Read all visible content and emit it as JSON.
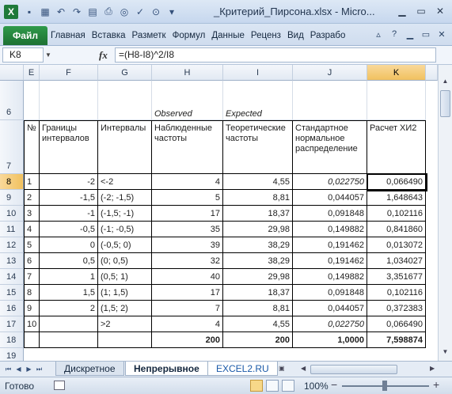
{
  "window": {
    "title": "_Критерий_Пирсона.xlsx - Micro...",
    "app_icon": "X"
  },
  "ribbon": {
    "file": "Файл",
    "tabs": [
      "Главная",
      "Вставка",
      "Разметк",
      "Формул",
      "Данные",
      "Реценз",
      "Вид",
      "Разрабо"
    ]
  },
  "formula_bar": {
    "name_box": "K8",
    "fx": "fx",
    "formula": "=(H8-I8)^2/I8"
  },
  "columns": [
    "E",
    "F",
    "G",
    "H",
    "I",
    "J",
    "K"
  ],
  "selected_column": "K",
  "rows": {
    "r6": {
      "num": "6",
      "H": "Observed",
      "I": "Expected"
    },
    "r7": {
      "num": "7",
      "E": "№",
      "F": "Границы интервалов",
      "G": "Интервалы",
      "H": "Наблюденные частоты",
      "I": "Теоретические частоты",
      "J": "Стандартное нормальное распределение",
      "K": "Расчет ХИ2"
    },
    "data": [
      {
        "num": "8",
        "E": "1",
        "F": "-2",
        "G": "<-2",
        "H": "4",
        "I": "4,55",
        "J": "0,022750",
        "K": "0,066490"
      },
      {
        "num": "9",
        "E": "2",
        "F": "-1,5",
        "G": "(-2; -1,5)",
        "H": "5",
        "I": "8,81",
        "J": "0,044057",
        "K": "1,648643"
      },
      {
        "num": "10",
        "E": "3",
        "F": "-1",
        "G": "(-1,5; -1)",
        "H": "17",
        "I": "18,37",
        "J": "0,091848",
        "K": "0,102116"
      },
      {
        "num": "11",
        "E": "4",
        "F": "-0,5",
        "G": "(-1; -0,5)",
        "H": "35",
        "I": "29,98",
        "J": "0,149882",
        "K": "0,841860"
      },
      {
        "num": "12",
        "E": "5",
        "F": "0",
        "G": "(-0,5; 0)",
        "H": "39",
        "I": "38,29",
        "J": "0,191462",
        "K": "0,013072"
      },
      {
        "num": "13",
        "E": "6",
        "F": "0,5",
        "G": "(0; 0,5)",
        "H": "32",
        "I": "38,29",
        "J": "0,191462",
        "K": "1,034027"
      },
      {
        "num": "14",
        "E": "7",
        "F": "1",
        "G": "(0,5; 1)",
        "H": "40",
        "I": "29,98",
        "J": "0,149882",
        "K": "3,351677"
      },
      {
        "num": "15",
        "E": "8",
        "F": "1,5",
        "G": "(1; 1,5)",
        "H": "17",
        "I": "18,37",
        "J": "0,091848",
        "K": "0,102116"
      },
      {
        "num": "16",
        "E": "9",
        "F": "2",
        "G": "(1,5; 2)",
        "H": "7",
        "I": "8,81",
        "J": "0,044057",
        "K": "0,372383"
      },
      {
        "num": "17",
        "E": "10",
        "F": "",
        "G": ">2",
        "H": "4",
        "I": "4,55",
        "J": "0,022750",
        "K": "0,066490"
      }
    ],
    "r18": {
      "num": "18",
      "H": "200",
      "I": "200",
      "J": "1,0000",
      "K": "7,598874"
    },
    "r19": {
      "num": "19"
    }
  },
  "sheets": [
    "Дискретное",
    "Непрерывное",
    "EXCEL2.RU"
  ],
  "active_sheet": "Непрерывное",
  "status": {
    "ready": "Готово",
    "zoom": "100%"
  }
}
